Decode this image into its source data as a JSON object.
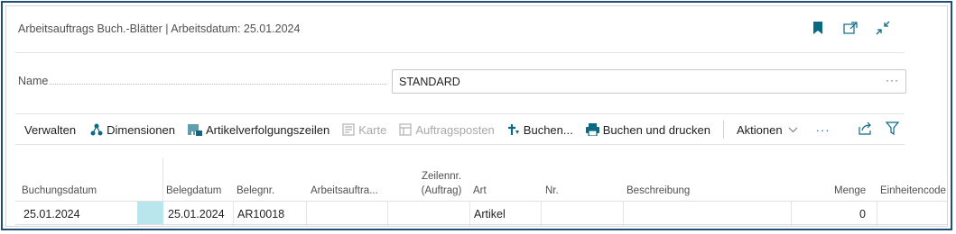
{
  "title": "Arbeitsauftrags Buch.-Blätter | Arbeitsdatum: 25.01.2024",
  "name_field": {
    "label": "Name",
    "value": "STANDARD",
    "more": "···"
  },
  "actions": {
    "verwalten": "Verwalten",
    "dimensionen": "Dimensionen",
    "artikelverfolgungszeilen": "Artikelverfolgungszeilen",
    "karte": "Karte",
    "auftragsposten": "Auftragsposten",
    "buchen": "Buchen...",
    "buchen_drucken": "Buchen und drucken",
    "aktionen": "Aktionen",
    "more": "···"
  },
  "columns": {
    "buchungsdatum": "Buchungsdatum",
    "belegdatum": "Belegdatum",
    "belegnr": "Belegnr.",
    "arbeitsauftrag": "Arbeitsauftra...",
    "zeilennr_1": "Zeilennr.",
    "zeilennr_2": "(Auftrag)",
    "art": "Art",
    "nr": "Nr.",
    "beschreibung": "Beschreibung",
    "menge": "Menge",
    "einheitencode": "Einheitencode"
  },
  "row": {
    "buchungsdatum": "25.01.2024",
    "belegdatum": "25.01.2024",
    "belegnr": "AR10018",
    "art": "Artikel",
    "menge": "0"
  },
  "colors": {
    "accent": "#0b6a83",
    "selected_cell": "#b8e6ec",
    "frame": "#1f4e79"
  },
  "icons": [
    "bookmark-icon",
    "open-new-window-icon",
    "collapse-icon",
    "share-icon",
    "filter-icon"
  ]
}
